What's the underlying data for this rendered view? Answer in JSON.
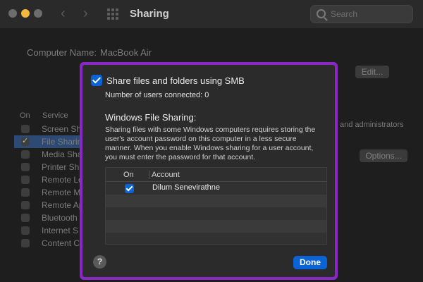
{
  "window": {
    "title": "Sharing",
    "back_icon": "‹",
    "forward_icon": "›",
    "search_placeholder": "Search"
  },
  "background": {
    "computer_name_label": "Computer Name:",
    "computer_name_value": "MacBook Air",
    "edit_label": "Edit...",
    "header_on": "On",
    "header_service": "Service",
    "services": [
      {
        "name": "Screen Sh",
        "checked": false
      },
      {
        "name": "File Sharin",
        "checked": true
      },
      {
        "name": "Media Sha",
        "checked": false
      },
      {
        "name": "Printer Sh",
        "checked": false
      },
      {
        "name": "Remote Lo",
        "checked": false
      },
      {
        "name": "Remote M",
        "checked": false
      },
      {
        "name": "Remote Ap",
        "checked": false
      },
      {
        "name": "Bluetooth",
        "checked": false
      },
      {
        "name": "Internet S",
        "checked": false
      },
      {
        "name": "Content C",
        "checked": false
      }
    ],
    "admins_text": "and administrators",
    "options_label": "Options..."
  },
  "sheet": {
    "smb_label": "Share files and folders using SMB",
    "smb_checked": true,
    "users_connected": "Number of users connected: 0",
    "windows_title": "Windows File Sharing:",
    "windows_desc": "Sharing files with some Windows computers requires storing the user's account password on this computer in a less secure manner. When you enable Windows sharing for a user account, you must enter the password for that account.",
    "table_col_on": "On",
    "table_col_account": "Account",
    "accounts": [
      {
        "name": "Dilum Senevirathne",
        "checked": true
      }
    ],
    "help_label": "?",
    "done_label": "Done"
  },
  "colors": {
    "highlight_border": "#8c27c7",
    "accent_blue": "#0a64d6"
  }
}
